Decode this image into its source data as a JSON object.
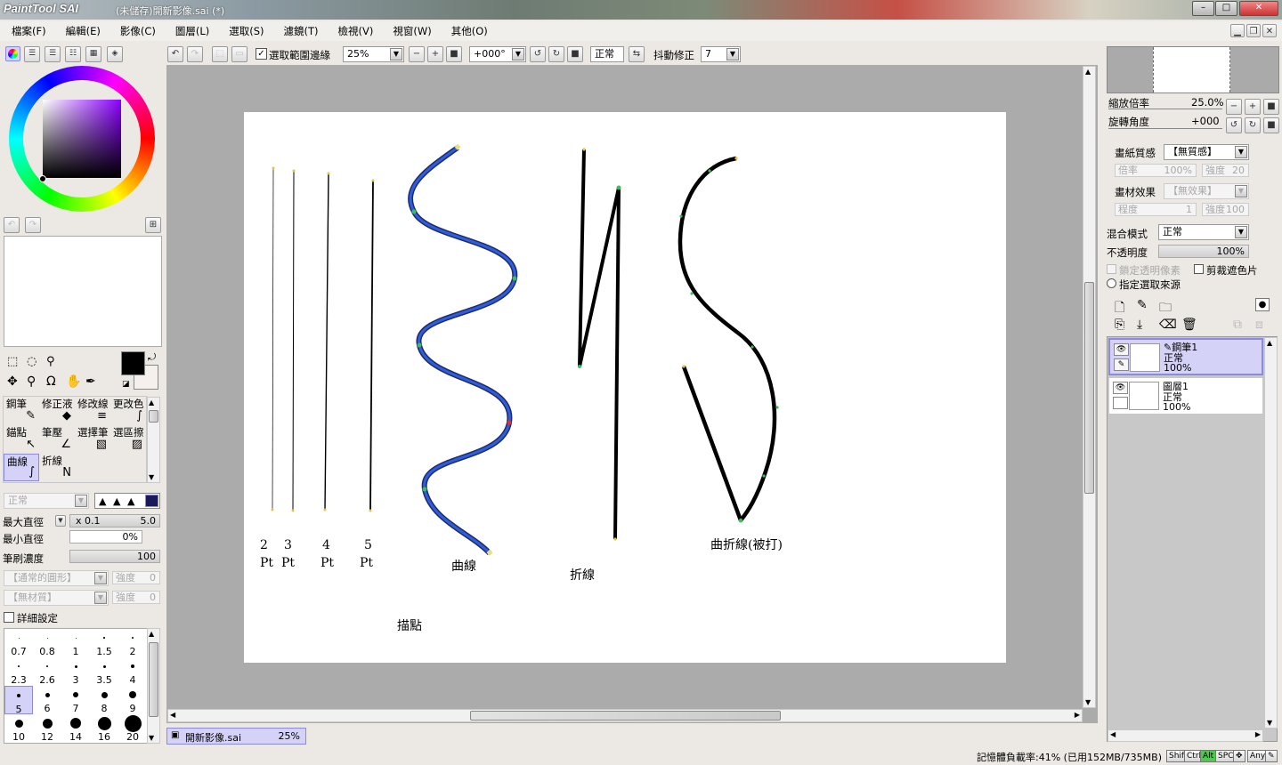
{
  "titlebar": {
    "logo": "PaintTool SAI",
    "title": "(未儲存)開新影像.sai (*)",
    "min": "–",
    "max": "□",
    "close": "✕"
  },
  "menu": [
    "檔案(F)",
    "編輯(E)",
    "影像(C)",
    "圖層(L)",
    "選取(S)",
    "濾鏡(T)",
    "檢視(V)",
    "視窗(W)",
    "其他(O)"
  ],
  "toolbar": {
    "antialias_label": "選取範圍邊緣",
    "zoom": "25%",
    "rotation": "+000°",
    "blend": "正常",
    "stabilizer_label": "抖動修正",
    "stabilizer_value": "7"
  },
  "tools": [
    {
      "label": "鋼筆",
      "icon": "✎"
    },
    {
      "label": "修正液",
      "icon": "◆"
    },
    {
      "label": "修改線",
      "icon": "≡"
    },
    {
      "label": "更改色",
      "icon": "∫"
    },
    {
      "label": "錨點",
      "icon": "↖"
    },
    {
      "label": "筆壓",
      "icon": "∠"
    },
    {
      "label": "選擇筆",
      "icon": "▧"
    },
    {
      "label": "選區擦",
      "icon": "▨"
    },
    {
      "label": "曲線",
      "icon": "∫"
    },
    {
      "label": "折線",
      "icon": "N"
    }
  ],
  "tool_options": {
    "mode": "正常",
    "max_size_label": "最大直徑",
    "max_size_mult": "x 0.1",
    "max_size_value": "5.0",
    "min_size_label": "最小直徑",
    "min_size_value": "0%",
    "density_label": "筆刷濃度",
    "density_value": "100",
    "shape": "【通常的圓形】",
    "shape_strength_label": "強度",
    "shape_strength": "0",
    "texture": "【無材質】",
    "texture_strength_label": "強度",
    "texture_strength": "0",
    "advanced_label": "詳細設定"
  },
  "brush_sizes": [
    "0.7",
    "0.8",
    "1",
    "1.5",
    "2",
    "2.3",
    "2.6",
    "3",
    "3.5",
    "4",
    "5",
    "6",
    "7",
    "8",
    "9",
    "10",
    "12",
    "14",
    "16",
    "20"
  ],
  "brush_selected": "5",
  "navigator": {
    "zoom_label": "縮放倍率",
    "zoom_value": "25.0%",
    "angle_label": "旋轉角度",
    "angle_value": "+000"
  },
  "layer_props": {
    "paper_label": "畫紙質感",
    "paper_value": "【無質感】",
    "paper_scale_label": "倍率",
    "paper_scale": "100%",
    "paper_strength_label": "強度",
    "paper_strength": "20",
    "effect_label": "畫材效果",
    "effect_value": "【無效果】",
    "effect_degree_label": "程度",
    "effect_degree": "1",
    "effect_strength_label": "強度",
    "effect_strength": "100",
    "blend_label": "混合模式",
    "blend_value": "正常",
    "opacity_label": "不透明度",
    "opacity_value": "100%",
    "lock_label": "鎖定透明像素",
    "clip_label": "剪裁遮色片",
    "source_label": "指定選取來源"
  },
  "layers": [
    {
      "name": "鋼筆1",
      "mode": "正常",
      "opacity": "100%",
      "selected": true
    },
    {
      "name": "圖層1",
      "mode": "正常",
      "opacity": "100%",
      "selected": false
    }
  ],
  "canvas_labels": {
    "pt2": "2",
    "pt3": "3",
    "pt4": "4",
    "pt5": "5",
    "pt": "Pt",
    "curve": "曲線",
    "polyline": "折線",
    "anchor": "描點",
    "curve_poly": "曲折線(被打)"
  },
  "doc_tab": {
    "name": "開新影像.sai",
    "zoom": "25%"
  },
  "status": {
    "memory": "記憶體負載率:41% (已用152MB/735MB)",
    "keys": [
      "Shift",
      "Ctrl",
      "Alt",
      "SPC",
      "✥",
      "Any",
      "✎"
    ]
  }
}
